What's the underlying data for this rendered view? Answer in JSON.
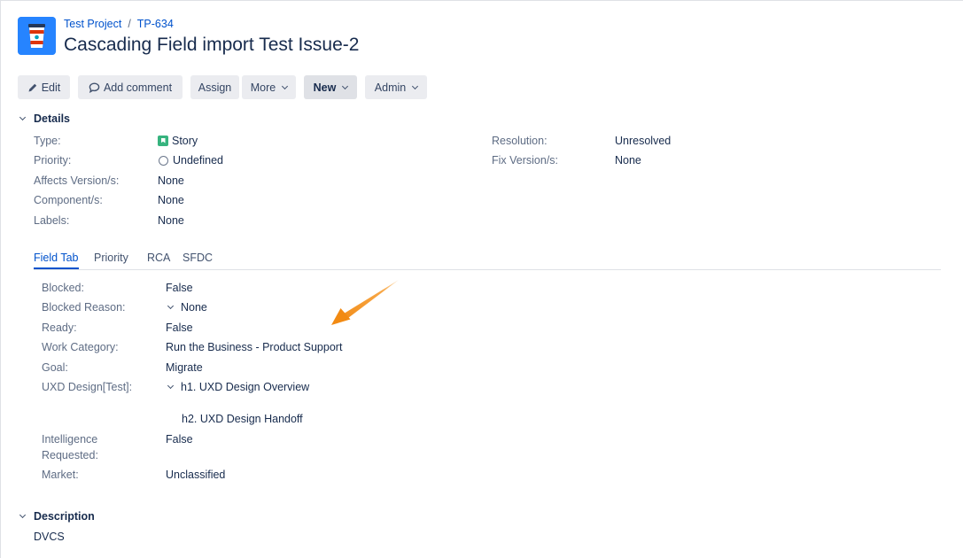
{
  "breadcrumb": {
    "project": "Test Project",
    "separator": "/",
    "issue_key": "TP-634"
  },
  "issue": {
    "title": "Cascading Field import Test Issue-2"
  },
  "toolbar": {
    "edit": "Edit",
    "add_comment": "Add comment",
    "assign": "Assign",
    "more": "More",
    "new": "New",
    "admin": "Admin"
  },
  "details": {
    "heading": "Details",
    "type": {
      "label": "Type:",
      "value": "Story"
    },
    "priority": {
      "label": "Priority:",
      "value": "Undefined"
    },
    "affects": {
      "label": "Affects Version/s:",
      "value": "None"
    },
    "components": {
      "label": "Component/s:",
      "value": "None"
    },
    "labels": {
      "label": "Labels:",
      "value": "None"
    },
    "resolution": {
      "label": "Resolution:",
      "value": "Unresolved"
    },
    "fix_versions": {
      "label": "Fix Version/s:",
      "value": "None"
    }
  },
  "tabs": [
    "Field Tab",
    "Priority",
    "RCA",
    "SFDC"
  ],
  "fields": {
    "blocked": {
      "label": "Blocked:",
      "value": "False"
    },
    "blocked_reason": {
      "label": "Blocked Reason:",
      "value": "None"
    },
    "ready": {
      "label": "Ready:",
      "value": "False"
    },
    "work_category": {
      "label": "Work Category:",
      "value": "Run the Business - Product Support"
    },
    "goal": {
      "label": "Goal:",
      "value": "Migrate"
    },
    "uxd_design": {
      "label": "UXD Design[Test]:",
      "value": "h1. UXD Design Overview",
      "value2": "h2. UXD Design Handoff"
    },
    "intelligence": {
      "label_line1": "Intelligence",
      "label_line2": "Requested:",
      "value": "False"
    },
    "market": {
      "label": "Market:",
      "value": "Unclassified"
    }
  },
  "description": {
    "heading": "Description",
    "text": "DVCS"
  },
  "colors": {
    "link": "#0052cc",
    "text": "#172b4d",
    "label": "#5e6c84",
    "button_bg": "#ebecf0",
    "story_icon": "#36b37e",
    "annotation_arrow": "#f6921e"
  }
}
